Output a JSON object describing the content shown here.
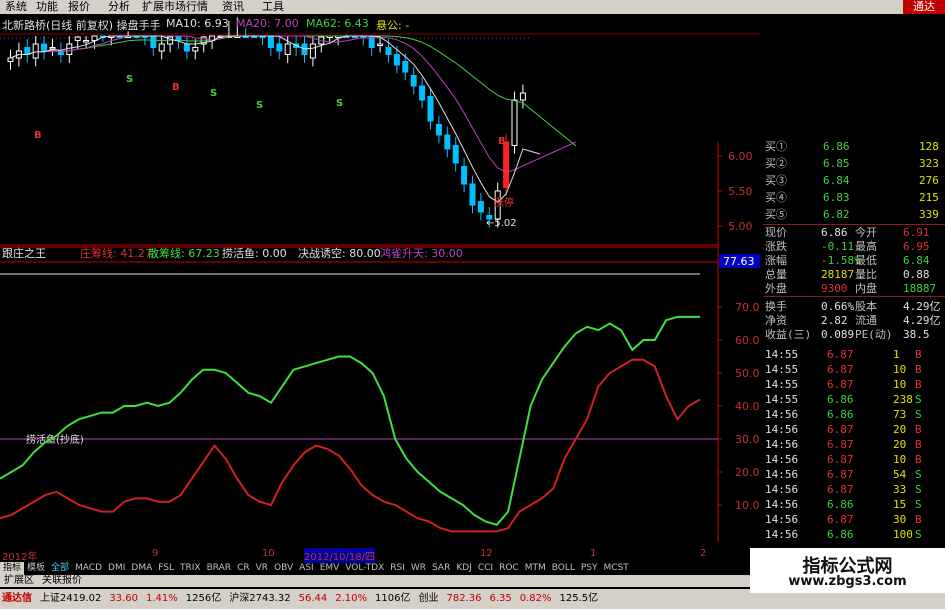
{
  "menu": [
    "系统",
    "功能",
    "报价",
    "分析",
    "扩展市场行情",
    "资讯",
    "工具"
  ],
  "menu_brand": "通达",
  "chart_title": "北新路桥(日线 前复权) 操盘手手",
  "ma": [
    {
      "label": "MA10: 6.93",
      "color": "#e0e0e0"
    },
    {
      "label": "MA20: 7.00",
      "color": "#c040c0"
    },
    {
      "label": "MA62: 6.43",
      "color": "#40d040"
    },
    {
      "label": "悬公: -",
      "color": "#e0e000"
    }
  ],
  "price_axis": [
    "6.00",
    "5.50",
    "5.00"
  ],
  "low_label": "5.02",
  "limit_label": "涨停",
  "signals": [
    "S",
    "B",
    "S",
    "S",
    "S",
    "B",
    "B"
  ],
  "indicator": {
    "name": "跟庄之王",
    "items": [
      {
        "label": "庄筹线: 41.27",
        "color": "#e03030"
      },
      {
        "label": "散筹线: 67.23",
        "color": "#40e040"
      },
      {
        "label": "捞活鱼: 0.00",
        "color": "#e0e0e0"
      },
      {
        "label": "决战诱空: 80.00",
        "color": "#e0e0e0"
      },
      {
        "label": "鸿雀升天: 30.00",
        "color": "#c040c0"
      }
    ],
    "current": "77.63",
    "axis": [
      "70.00",
      "60.00",
      "50.00",
      "40.00",
      "30.00",
      "20.00",
      "10.00"
    ],
    "level_label": "捞活鱼(抄底)",
    "chart_data": {
      "type": "line",
      "ylim": [
        0,
        80
      ],
      "series": [
        {
          "name": "散筹线",
          "color": "#3ee03e",
          "values": [
            18,
            20,
            22,
            26,
            29,
            31,
            34,
            36,
            37,
            38,
            38,
            40,
            40,
            41,
            40,
            41,
            44,
            48,
            51,
            51,
            50,
            47,
            44,
            43,
            41,
            46,
            51,
            52,
            53,
            54,
            55,
            55,
            53,
            50,
            43,
            30,
            24,
            20,
            17,
            14,
            12,
            10,
            7,
            5,
            4,
            8,
            24,
            40,
            48,
            53,
            58,
            62,
            64,
            63,
            65,
            63,
            57,
            60,
            60,
            66,
            67,
            67,
            67
          ]
        },
        {
          "name": "庄筹线",
          "color": "#d02020",
          "values": [
            6,
            7,
            9,
            11,
            13,
            14,
            12,
            10,
            9,
            8,
            8,
            11,
            12,
            12,
            11,
            11,
            13,
            18,
            23,
            28,
            24,
            18,
            13,
            11,
            10,
            17,
            22,
            26,
            28,
            27,
            25,
            21,
            16,
            13,
            11,
            10,
            8,
            6,
            5,
            3,
            2,
            2,
            2,
            2,
            2,
            3,
            8,
            10,
            12,
            15,
            24,
            30,
            36,
            46,
            50,
            52,
            54,
            54,
            52,
            43,
            36,
            40,
            42
          ]
        }
      ]
    }
  },
  "x_axis": {
    "labels": [
      "2012年",
      "9",
      "10",
      "2012/10/18/四",
      "12",
      "1",
      "2"
    ]
  },
  "tabs": [
    "指标",
    "模板",
    "全部",
    "MACD",
    "DMI",
    "DMA",
    "FSL",
    "TRIX",
    "BRAR",
    "CR",
    "VR",
    "OBV",
    "ASI",
    "EMV",
    "VOL-TDX",
    "RSI",
    "WR",
    "SAR",
    "KDJ",
    "CCI",
    "ROC",
    "MTM",
    "BOLL",
    "PSY",
    "MCST"
  ],
  "ext_tabs": [
    "扩展区",
    "关联报价"
  ],
  "buy_orders": [
    {
      "label": "买①",
      "price": "6.86",
      "vol": "128"
    },
    {
      "label": "买②",
      "price": "6.85",
      "vol": "323"
    },
    {
      "label": "买③",
      "price": "6.84",
      "vol": "276"
    },
    {
      "label": "买④",
      "price": "6.83",
      "vol": "215"
    },
    {
      "label": "买⑤",
      "price": "6.82",
      "vol": "339"
    }
  ],
  "quote": [
    {
      "l1": "现价",
      "v1": "6.86",
      "l2": "今开",
      "v2": "6.91"
    },
    {
      "l1": "涨跌",
      "v1": "-0.11",
      "l2": "最高",
      "v2": "6.95"
    },
    {
      "l1": "涨幅",
      "v1": "-1.58%",
      "l2": "最低",
      "v2": "6.84"
    },
    {
      "l1": "总量",
      "v1": "28187",
      "l2": "量比",
      "v2": "0.88"
    },
    {
      "l1": "外盘",
      "v1": "9300",
      "l2": "内盘",
      "v2": "18887"
    },
    {
      "l1": "换手",
      "v1": "0.66%",
      "l2": "股本",
      "v2": "4.29亿"
    },
    {
      "l1": "净资",
      "v1": "2.82",
      "l2": "流通",
      "v2": "4.29亿"
    },
    {
      "l1": "收益(三)",
      "v1": "0.089",
      "l2": "PE(动)",
      "v2": "38.5"
    }
  ],
  "ticks": [
    {
      "t": "14:55",
      "p": "6.87",
      "v": "1",
      "s": "B"
    },
    {
      "t": "14:55",
      "p": "6.87",
      "v": "10",
      "s": "B"
    },
    {
      "t": "14:55",
      "p": "6.87",
      "v": "10",
      "s": "B"
    },
    {
      "t": "14:55",
      "p": "6.86",
      "v": "238",
      "s": "S"
    },
    {
      "t": "14:56",
      "p": "6.86",
      "v": "73",
      "s": "S"
    },
    {
      "t": "14:56",
      "p": "6.87",
      "v": "20",
      "s": "B"
    },
    {
      "t": "14:56",
      "p": "6.87",
      "v": "20",
      "s": "B"
    },
    {
      "t": "14:56",
      "p": "6.87",
      "v": "10",
      "s": "B"
    },
    {
      "t": "14:56",
      "p": "6.87",
      "v": "54",
      "s": "S"
    },
    {
      "t": "14:56",
      "p": "6.87",
      "v": "33",
      "s": "S"
    },
    {
      "t": "14:56",
      "p": "6.86",
      "v": "15",
      "s": "S"
    },
    {
      "t": "14:56",
      "p": "6.87",
      "v": "30",
      "s": "B"
    },
    {
      "t": "14:56",
      "p": "6.86",
      "v": "100",
      "s": "S"
    }
  ],
  "status": [
    {
      "text": "通达信",
      "color": "#c00000"
    },
    {
      "text": "上证2419.02",
      "color": "#000000"
    },
    {
      "text": "33.60",
      "color": "#c00000"
    },
    {
      "text": "1.41%",
      "color": "#c00000"
    },
    {
      "text": "1256亿",
      "color": "#000000"
    },
    {
      "text": "沪深2743.32",
      "color": "#000000"
    },
    {
      "text": "56.44",
      "color": "#c00000"
    },
    {
      "text": "2.10%",
      "color": "#c00000"
    },
    {
      "text": "1106亿",
      "color": "#000000"
    },
    {
      "text": "创业",
      "color": "#000000"
    },
    {
      "text": "782.36",
      "color": "#c00000"
    },
    {
      "text": "6.35",
      "color": "#c00000"
    },
    {
      "text": "0.82%",
      "color": "#c00000"
    },
    {
      "text": "125.5亿",
      "color": "#000000"
    }
  ],
  "watermark": {
    "title": "指标公式网",
    "url": "www.zbgs3.com"
  }
}
